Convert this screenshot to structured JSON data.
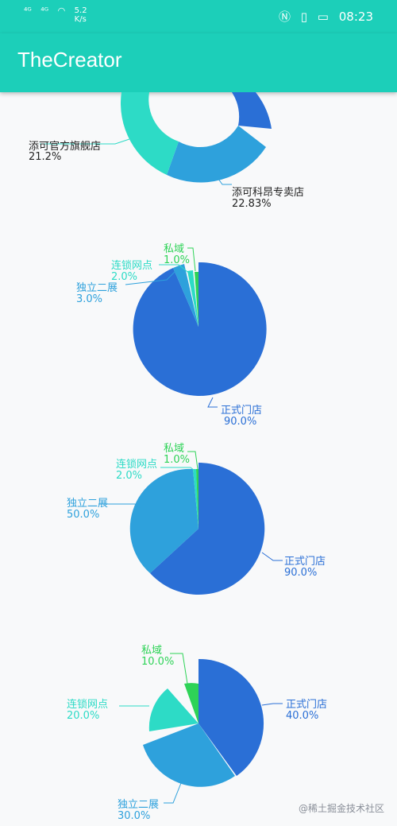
{
  "status_bar": {
    "signal1": "⁴ᴳ",
    "signal2": "⁴ᴳ",
    "network_speed": "5.2",
    "speed_unit": "K/s",
    "time": "08:23"
  },
  "app_bar": {
    "title": "TheCreator"
  },
  "watermark": "@稀土掘金技术社区",
  "chart_data": [
    {
      "type": "pie",
      "variant": "donut",
      "labels": [
        {
          "name": "添可官方旗舰店",
          "value": "21.2%"
        },
        {
          "name": "添可科昂专卖店",
          "value": "22.83%"
        }
      ],
      "label_color": "#222222"
    },
    {
      "type": "pie",
      "slices": [
        {
          "name": "正式门店",
          "value": "90.0%",
          "color": "#2a6fd6"
        },
        {
          "name": "独立二展",
          "value": "3.0%",
          "color": "#2ea1dc"
        },
        {
          "name": "连锁网点",
          "value": "2.0%",
          "color": "#2ddbc6"
        },
        {
          "name": "私域",
          "value": "1.0%",
          "color": "#2ed357"
        }
      ]
    },
    {
      "type": "pie",
      "variant": "rose",
      "slices": [
        {
          "name": "正式门店",
          "value": "90.0%",
          "color": "#2a6fd6"
        },
        {
          "name": "独立二展",
          "value": "50.0%",
          "color": "#2ea1dc"
        },
        {
          "name": "连锁网点",
          "value": "2.0%",
          "color": "#2ddbc6"
        },
        {
          "name": "私域",
          "value": "1.0%",
          "color": "#2ed357"
        }
      ]
    },
    {
      "type": "pie",
      "variant": "rose",
      "slices": [
        {
          "name": "正式门店",
          "value": "40.0%",
          "color": "#2a6fd6"
        },
        {
          "name": "独立二展",
          "value": "30.0%",
          "color": "#2ea1dc"
        },
        {
          "name": "连锁网点",
          "value": "20.0%",
          "color": "#2ddbc6"
        },
        {
          "name": "私域",
          "value": "10.0%",
          "color": "#2ed357"
        }
      ]
    }
  ]
}
